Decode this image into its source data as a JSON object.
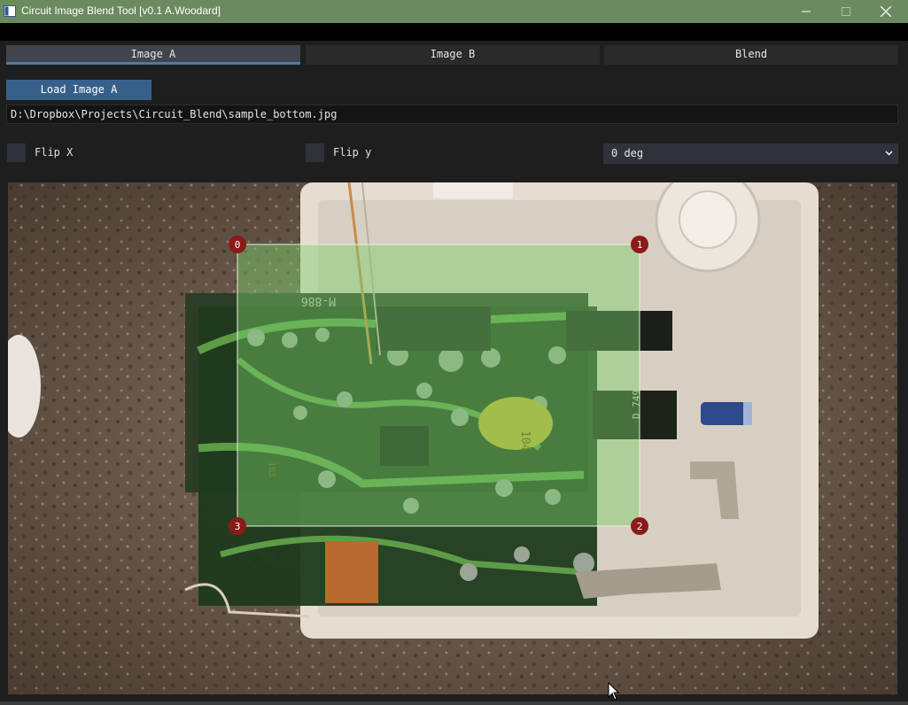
{
  "window": {
    "title": "Circuit Image Blend Tool [v0.1 A.Woodard]",
    "icon": "app-window-icon",
    "controls": [
      "minimize-icon",
      "maximize-icon",
      "close-icon"
    ]
  },
  "tabs": [
    {
      "label": "Image A",
      "active": true
    },
    {
      "label": "Image B",
      "active": false
    },
    {
      "label": "Blend",
      "active": false
    }
  ],
  "load_button": {
    "label": "Load Image A"
  },
  "path": {
    "value": "D:\\Dropbox\\Projects\\Circuit_Blend\\sample_bottom.jpg"
  },
  "options": {
    "flip_x": {
      "label": "Flip X",
      "checked": false
    },
    "flip_y": {
      "label": "Flip y",
      "checked": false
    },
    "rotation": {
      "selected": "0 deg"
    }
  },
  "overlay": {
    "corners": [
      {
        "label": "0"
      },
      {
        "label": "1"
      },
      {
        "label": "2"
      },
      {
        "label": "3"
      }
    ],
    "accent_color": "#8b1a1a",
    "fill_color": "#7bd06a"
  },
  "image": {
    "board_markings": {
      "top": "M-886",
      "cap": "104",
      "chip": "D 749",
      "small": "103"
    }
  },
  "colors": {
    "titlebar": "#6b8a5f",
    "tab_active_underline": "#4f7ba3",
    "button": "#36608a"
  }
}
